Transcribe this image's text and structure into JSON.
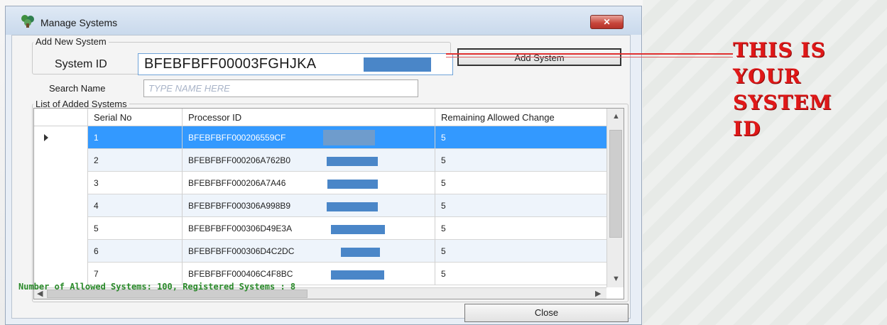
{
  "window": {
    "title": "Manage Systems",
    "close_label": "✕"
  },
  "add_group": {
    "label": "Add New System",
    "system_id_label": "System ID",
    "system_id_value": "BFEBFBFF00003FGHJKA",
    "add_button": "Add System"
  },
  "search": {
    "label": "Search Name",
    "placeholder": "TYPE NAME HERE"
  },
  "list_group": {
    "label": "List of Added Systems",
    "columns": [
      "Serial No",
      "Processor ID",
      "Remaining Allowed Change"
    ],
    "rows": [
      {
        "serial": "1",
        "processor_id": "BFEBFBFF000206559CF",
        "remaining": "5"
      },
      {
        "serial": "2",
        "processor_id": "BFEBFBFF000206A762B0",
        "remaining": "5"
      },
      {
        "serial": "3",
        "processor_id": "BFEBFBFF000206A7A46",
        "remaining": "5"
      },
      {
        "serial": "4",
        "processor_id": "BFEBFBFF000306A998B9",
        "remaining": "5"
      },
      {
        "serial": "5",
        "processor_id": "BFEBFBFF000306D49E3A",
        "remaining": "5"
      },
      {
        "serial": "6",
        "processor_id": "BFEBFBFF000306D4C2DC",
        "remaining": "5"
      },
      {
        "serial": "7",
        "processor_id": "BFEBFBFF000406C4F8BC",
        "remaining": "5"
      }
    ]
  },
  "status_text": "Number of Allowed Systems: 100, Registered Systems : 8",
  "close_button": "Close",
  "annotation": [
    "THIS IS",
    "YOUR",
    "SYSTEM",
    "ID"
  ],
  "colors": {
    "selection": "#3399ff",
    "annotation": "#e01818",
    "redaction": "#4a86c8",
    "status": "#2a8a2a"
  }
}
